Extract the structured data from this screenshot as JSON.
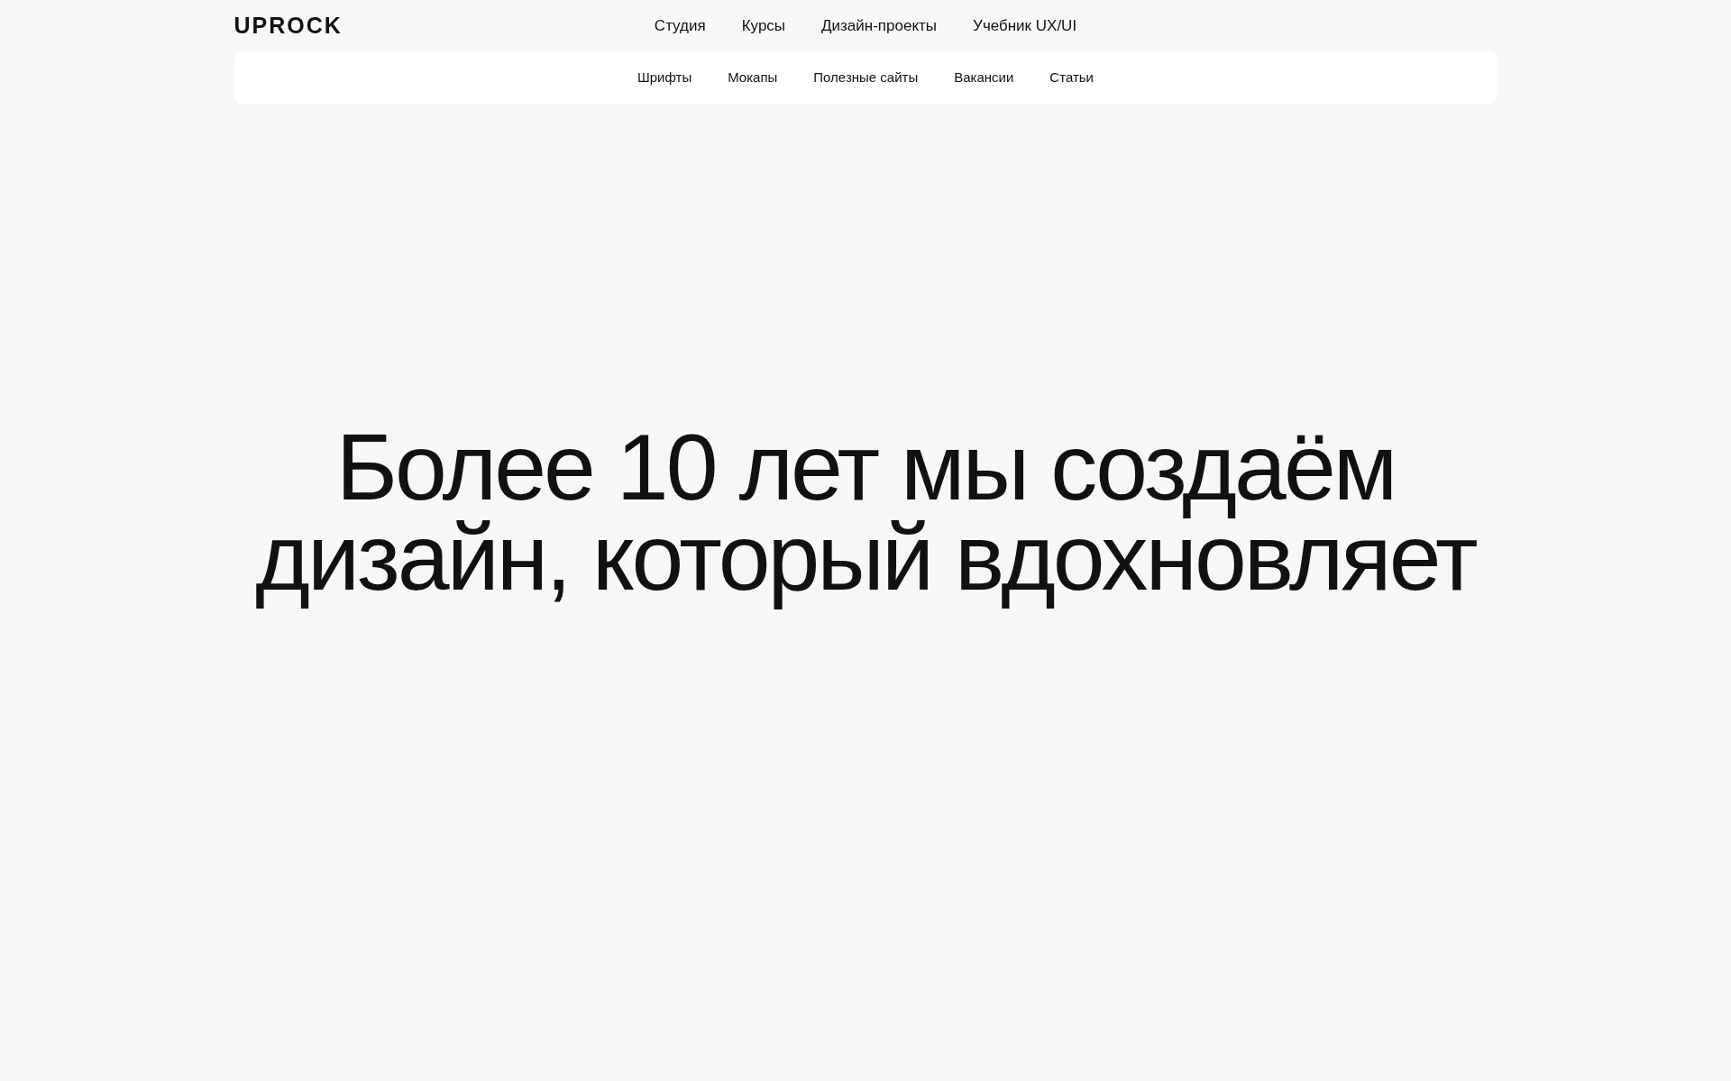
{
  "header": {
    "logo": "UPROCK",
    "nav": [
      "Студия",
      "Курсы",
      "Дизайн-проекты",
      "Учебник UX/UI"
    ]
  },
  "subnav": [
    "Шрифты",
    "Мокапы",
    "Полезные сайты",
    "Вакансии",
    "Статьи"
  ],
  "hero": {
    "title_lines": [
      "Более 10 лет мы создаём",
      "дизайн, который вдохновляет"
    ]
  }
}
